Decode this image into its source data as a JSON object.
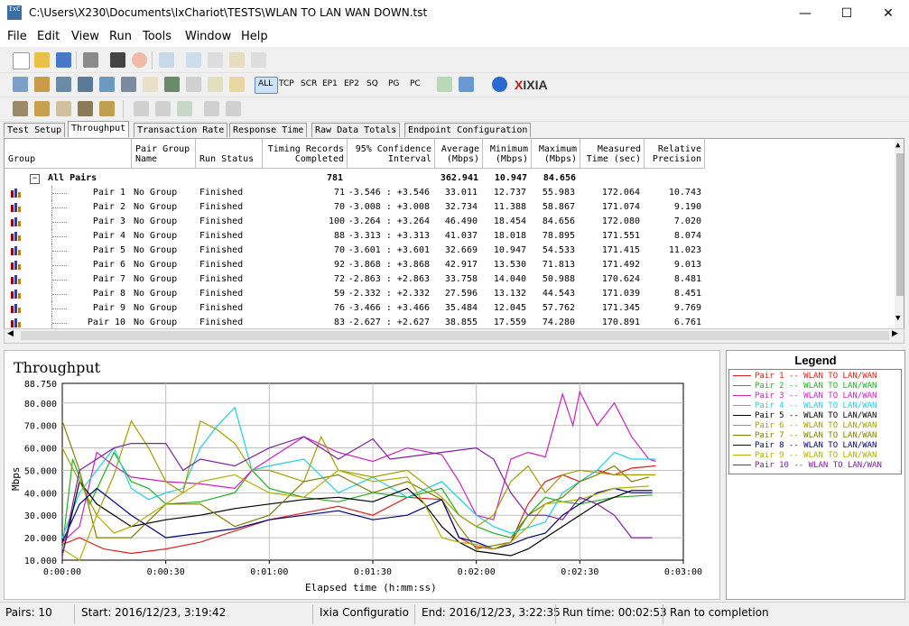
{
  "window": {
    "title": "C:\\Users\\X230\\Documents\\IxChariot\\TESTS\\WLAN TO LAN WAN DOWN.tst",
    "icon_text": "IxC",
    "minimize": "—",
    "maximize": "☐",
    "close": "✕"
  },
  "menu": [
    "File",
    "Edit",
    "View",
    "Run",
    "Tools",
    "Window",
    "Help"
  ],
  "toolbar2": {
    "all": "ALL",
    "tcp": "TCP",
    "scr": "SCR",
    "ep1": "EP1",
    "ep2": "EP2",
    "sq": "SQ",
    "pg": "PG",
    "pc": "PC"
  },
  "brand": {
    "prefix": "X",
    "name": "IXIA"
  },
  "tabs": [
    "Test Setup",
    "Throughput",
    "Transaction Rate",
    "Response Time",
    "Raw Data Totals",
    "Endpoint Configuration"
  ],
  "table": {
    "headers": {
      "group": "Group",
      "pair_group": "Pair Group\nName",
      "run_status": "Run Status",
      "timing": "Timing Records\nCompleted",
      "ci": "95% Confidence\nInterval",
      "avg": "Average\n(Mbps)",
      "min": "Minimum\n(Mbps)",
      "max": "Maximum\n(Mbps)",
      "measured": "Measured\nTime (sec)",
      "precision": "Relative\nPrecision"
    },
    "summary": {
      "expander": "−",
      "label": "All Pairs",
      "records": "781",
      "avg": "362.941",
      "min": "10.947",
      "max": "84.656"
    },
    "rows": [
      {
        "pair": "Pair 1",
        "group": "No Group",
        "status": "Finished",
        "records": "71",
        "ci": "-3.546 : +3.546",
        "avg": "33.011",
        "min": "12.737",
        "max": "55.983",
        "time": "172.064",
        "prec": "10.743"
      },
      {
        "pair": "Pair 2",
        "group": "No Group",
        "status": "Finished",
        "records": "70",
        "ci": "-3.008 : +3.008",
        "avg": "32.734",
        "min": "11.388",
        "max": "58.867",
        "time": "171.074",
        "prec": "9.190"
      },
      {
        "pair": "Pair 3",
        "group": "No Group",
        "status": "Finished",
        "records": "100",
        "ci": "-3.264 : +3.264",
        "avg": "46.490",
        "min": "18.454",
        "max": "84.656",
        "time": "172.080",
        "prec": "7.020"
      },
      {
        "pair": "Pair 4",
        "group": "No Group",
        "status": "Finished",
        "records": "88",
        "ci": "-3.313 : +3.313",
        "avg": "41.037",
        "min": "18.018",
        "max": "78.895",
        "time": "171.551",
        "prec": "8.074"
      },
      {
        "pair": "Pair 5",
        "group": "No Group",
        "status": "Finished",
        "records": "70",
        "ci": "-3.601 : +3.601",
        "avg": "32.669",
        "min": "10.947",
        "max": "54.533",
        "time": "171.415",
        "prec": "11.023"
      },
      {
        "pair": "Pair 6",
        "group": "No Group",
        "status": "Finished",
        "records": "92",
        "ci": "-3.868 : +3.868",
        "avg": "42.917",
        "min": "13.530",
        "max": "71.813",
        "time": "171.492",
        "prec": "9.013"
      },
      {
        "pair": "Pair 7",
        "group": "No Group",
        "status": "Finished",
        "records": "72",
        "ci": "-2.863 : +2.863",
        "avg": "33.758",
        "min": "14.040",
        "max": "50.988",
        "time": "170.624",
        "prec": "8.481"
      },
      {
        "pair": "Pair 8",
        "group": "No Group",
        "status": "Finished",
        "records": "59",
        "ci": "-2.332 : +2.332",
        "avg": "27.596",
        "min": "13.132",
        "max": "44.543",
        "time": "171.039",
        "prec": "8.451"
      },
      {
        "pair": "Pair 9",
        "group": "No Group",
        "status": "Finished",
        "records": "76",
        "ci": "-3.466 : +3.466",
        "avg": "35.484",
        "min": "12.045",
        "max": "57.762",
        "time": "171.345",
        "prec": "9.769"
      },
      {
        "pair": "Pair 10",
        "group": "No Group",
        "status": "Finished",
        "records": "83",
        "ci": "-2.627 : +2.627",
        "avg": "38.855",
        "min": "17.559",
        "max": "74.280",
        "time": "170.891",
        "prec": "6.761"
      }
    ]
  },
  "legend": {
    "title": "Legend",
    "entries": [
      "Pair 1 -- WLAN TO LAN/WAN",
      "Pair 2 -- WLAN TO LAN/WAN",
      "Pair 3 -- WLAN TO LAN/WAN",
      "Pair 4 -- WLAN TO LAN/WAN",
      "Pair 5 -- WLAN TO LAN/WAN",
      "Pair 6 -- WLAN TO LAN/WAN",
      "Pair 7 -- WLAN TO LAN/WAN",
      "Pair 8 -- WLAN TO LAN/WAN",
      "Pair 9 -- WLAN TO LAN/WAN",
      "Pair 10 -- WLAN TO LAN/WAN"
    ]
  },
  "chart_data": {
    "type": "line",
    "title": "Throughput",
    "xlabel": "Elapsed time (h:mm:ss)",
    "ylabel": "Mbps",
    "xlim": [
      0,
      180
    ],
    "ylim": [
      10,
      88.75
    ],
    "x_ticks": [
      "0:00:00",
      "0:00:30",
      "0:01:00",
      "0:01:30",
      "0:02:00",
      "0:02:30",
      "0:03:00"
    ],
    "y_ticks": [
      "10.000",
      "20.000",
      "30.000",
      "40.000",
      "50.000",
      "60.000",
      "70.000",
      "80.000",
      "88.750"
    ],
    "grid": true,
    "series": [
      {
        "name": "Pair 1",
        "color": "#e0201a",
        "x": [
          0,
          5,
          12,
          20,
          30,
          40,
          50,
          60,
          70,
          80,
          90,
          100,
          110,
          115,
          120,
          125,
          130,
          135,
          140,
          145,
          150,
          155,
          160,
          165,
          172
        ],
        "y": [
          17,
          20,
          15,
          13,
          15,
          18,
          23,
          28,
          31,
          34,
          30,
          38,
          37,
          20,
          16,
          15,
          18,
          35,
          45,
          48,
          45,
          50,
          48,
          51,
          52
        ]
      },
      {
        "name": "Pair 2",
        "color": "#20b020",
        "x": [
          0,
          3,
          8,
          15,
          20,
          25,
          30,
          40,
          50,
          55,
          60,
          70,
          80,
          90,
          100,
          110,
          115,
          120,
          125,
          130,
          135,
          140,
          145,
          150,
          160,
          171
        ],
        "y": [
          15,
          55,
          35,
          58,
          45,
          42,
          35,
          36,
          40,
          50,
          42,
          38,
          36,
          40,
          38,
          42,
          30,
          25,
          22,
          20,
          30,
          38,
          36,
          35,
          38,
          39
        ]
      },
      {
        "name": "Pair 3",
        "color": "#d020c0",
        "x": [
          0,
          5,
          10,
          15,
          20,
          30,
          40,
          50,
          55,
          60,
          70,
          80,
          90,
          100,
          110,
          115,
          120,
          125,
          130,
          135,
          140,
          145,
          148,
          150,
          155,
          160,
          165,
          170,
          172
        ],
        "y": [
          18,
          25,
          58,
          52,
          47,
          45,
          44,
          42,
          50,
          55,
          65,
          58,
          54,
          60,
          57,
          45,
          30,
          28,
          55,
          58,
          56,
          84,
          70,
          85,
          70,
          80,
          65,
          55,
          54
        ]
      },
      {
        "name": "Pair 4",
        "color": "#20d0e0",
        "x": [
          0,
          5,
          15,
          20,
          25,
          30,
          35,
          40,
          45,
          50,
          55,
          60,
          70,
          80,
          90,
          100,
          110,
          120,
          125,
          130,
          140,
          145,
          150,
          155,
          160,
          165,
          172
        ],
        "y": [
          20,
          40,
          60,
          42,
          37,
          40,
          42,
          60,
          70,
          78,
          50,
          52,
          55,
          40,
          47,
          38,
          45,
          30,
          25,
          22,
          27,
          40,
          45,
          50,
          58,
          55,
          55
        ]
      },
      {
        "name": "Pair 5",
        "color": "#000000",
        "x": [
          0,
          5,
          10,
          20,
          30,
          40,
          50,
          60,
          70,
          80,
          90,
          100,
          105,
          110,
          115,
          120,
          125,
          130,
          135,
          140,
          145,
          150,
          155,
          160,
          165,
          171
        ],
        "y": [
          12,
          45,
          35,
          25,
          28,
          30,
          33,
          35,
          37,
          38,
          36,
          42,
          35,
          25,
          18,
          14,
          13,
          12,
          15,
          20,
          25,
          30,
          35,
          38,
          41,
          41
        ]
      },
      {
        "name": "Pair 6",
        "color": "#a0a000",
        "x": [
          0,
          5,
          10,
          15,
          20,
          25,
          30,
          35,
          40,
          45,
          50,
          55,
          60,
          70,
          75,
          80,
          90,
          100,
          110,
          115,
          120,
          125,
          130,
          135,
          140,
          145,
          150,
          160,
          172
        ],
        "y": [
          60,
          45,
          30,
          48,
          72,
          60,
          45,
          40,
          72,
          68,
          62,
          50,
          50,
          45,
          65,
          50,
          47,
          50,
          38,
          30,
          25,
          30,
          45,
          52,
          40,
          48,
          50,
          48,
          48
        ]
      },
      {
        "name": "Pair 7",
        "color": "#808000",
        "x": [
          0,
          5,
          10,
          20,
          30,
          40,
          50,
          60,
          70,
          80,
          90,
          100,
          110,
          115,
          120,
          130,
          135,
          140,
          145,
          150,
          155,
          160,
          165,
          170
        ],
        "y": [
          72,
          50,
          20,
          20,
          35,
          35,
          25,
          30,
          45,
          48,
          40,
          45,
          37,
          25,
          15,
          18,
          30,
          35,
          38,
          45,
          48,
          52,
          45,
          47
        ]
      },
      {
        "name": "Pair 8",
        "color": "#000080",
        "x": [
          0,
          5,
          10,
          20,
          30,
          40,
          50,
          60,
          70,
          80,
          90,
          100,
          110,
          115,
          120,
          125,
          130,
          135,
          140,
          145,
          150,
          155,
          160,
          165,
          171
        ],
        "y": [
          18,
          35,
          42,
          30,
          20,
          22,
          24,
          28,
          30,
          32,
          28,
          30,
          37,
          20,
          18,
          15,
          17,
          20,
          22,
          30,
          35,
          40,
          42,
          40,
          40
        ]
      },
      {
        "name": "Pair 9",
        "color": "#b0b000",
        "x": [
          0,
          5,
          10,
          15,
          20,
          30,
          40,
          50,
          60,
          70,
          80,
          90,
          100,
          105,
          110,
          115,
          120,
          125,
          130,
          135,
          140,
          150,
          160,
          170
        ],
        "y": [
          15,
          10,
          30,
          22,
          25,
          35,
          45,
          48,
          40,
          38,
          50,
          45,
          47,
          35,
          20,
          18,
          17,
          15,
          18,
          25,
          35,
          37,
          42,
          43
        ]
      },
      {
        "name": "Pair 10",
        "color": "#8020a0",
        "x": [
          0,
          5,
          15,
          20,
          30,
          35,
          40,
          50,
          60,
          70,
          75,
          80,
          90,
          95,
          100,
          110,
          120,
          125,
          130,
          135,
          140,
          145,
          150,
          155,
          160,
          165,
          171
        ],
        "y": [
          12,
          50,
          60,
          62,
          62,
          50,
          55,
          52,
          60,
          65,
          60,
          55,
          64,
          55,
          56,
          58,
          60,
          55,
          40,
          30,
          30,
          28,
          38,
          35,
          30,
          20,
          20
        ]
      }
    ]
  },
  "status": {
    "pairs": "Pairs: 10",
    "start": "Start: 2016/12/23, 3:19:42",
    "config": "Ixia Configuratio",
    "end": "End: 2016/12/23, 3:22:35",
    "runtime": "Run time: 00:02:53",
    "completion": "Ran to completion"
  }
}
